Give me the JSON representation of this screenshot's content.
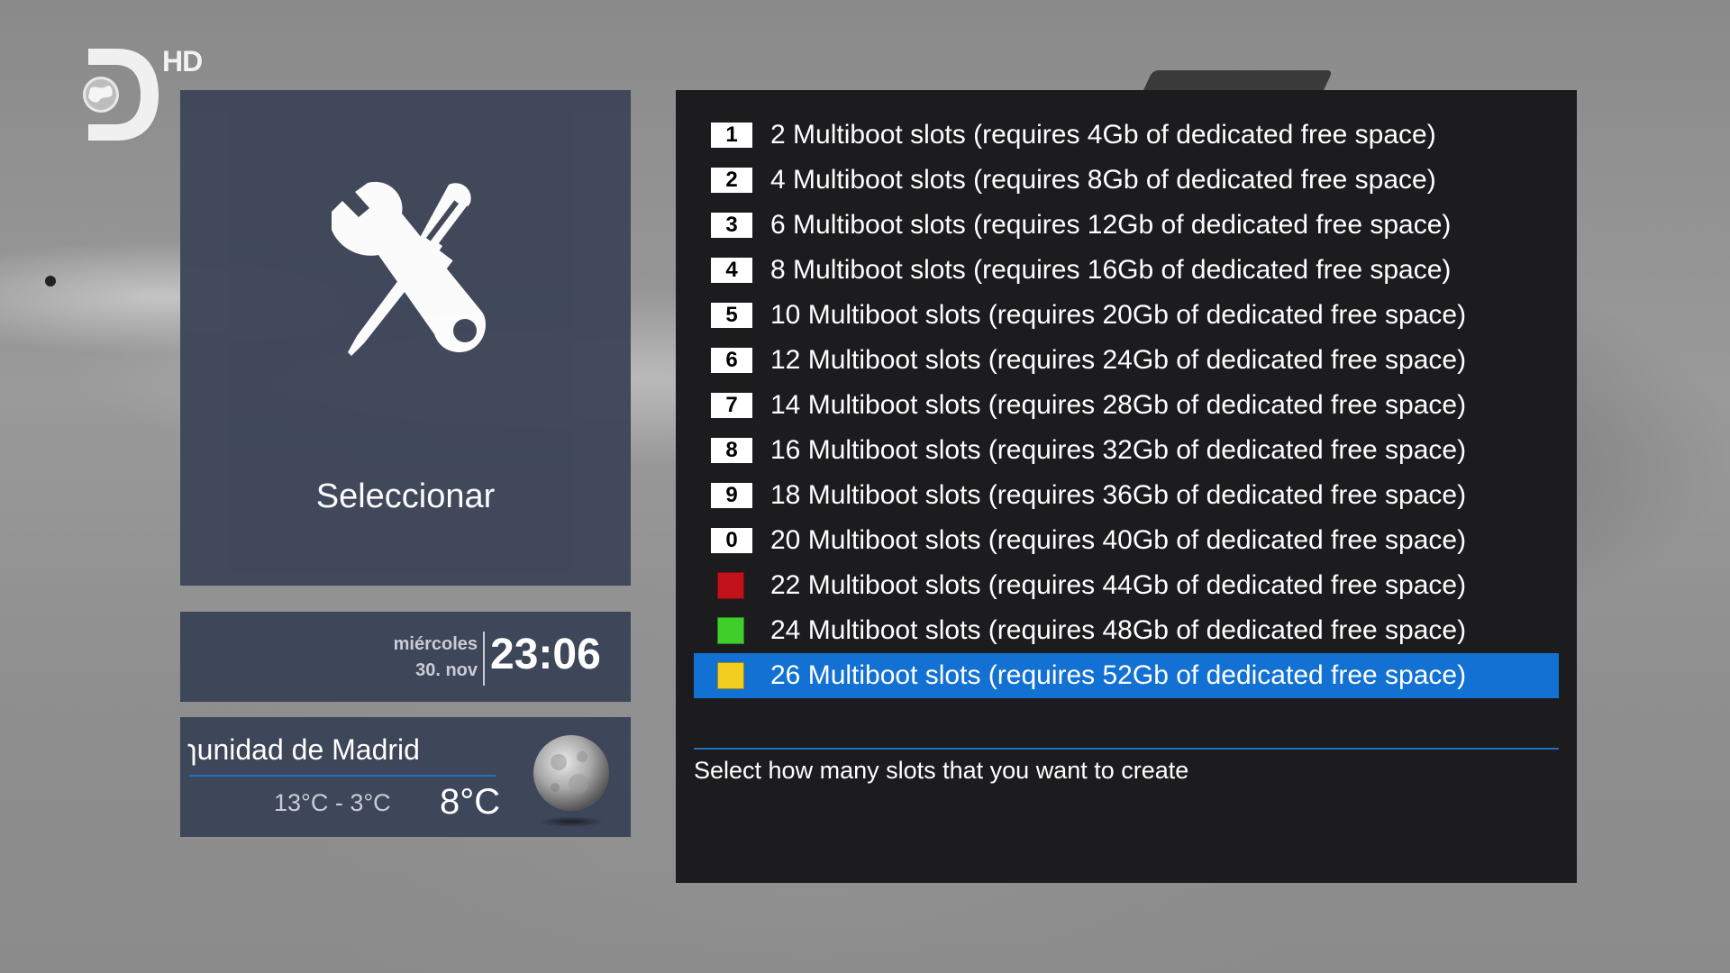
{
  "channel": {
    "logo_icon": "discovery-d-globe-icon",
    "hd_label": "HD"
  },
  "menu_panel": {
    "icon": "tools-wrench-screwdriver-icon",
    "label": "Seleccionar"
  },
  "clock": {
    "weekday": "miércoles",
    "date": "30. nov",
    "time": "23:06"
  },
  "weather": {
    "location": "ɿunidad de Madrid",
    "range": "13°C - 3°C",
    "temperature": "8°C",
    "icon": "moon-icon"
  },
  "list": {
    "selected_index": 12,
    "items": [
      {
        "key": "1",
        "label": "2 Multiboot slots (requires 4Gb of dedicated free space)"
      },
      {
        "key": "2",
        "label": "4 Multiboot slots (requires 8Gb of dedicated free space)"
      },
      {
        "key": "3",
        "label": "6 Multiboot slots (requires 12Gb of dedicated free space)"
      },
      {
        "key": "4",
        "label": "8 Multiboot slots (requires 16Gb of dedicated free space)"
      },
      {
        "key": "5",
        "label": "10 Multiboot slots (requires 20Gb of dedicated free space)"
      },
      {
        "key": "6",
        "label": "12 Multiboot slots (requires 24Gb of dedicated free space)"
      },
      {
        "key": "7",
        "label": "14 Multiboot slots (requires 28Gb of dedicated free space)"
      },
      {
        "key": "8",
        "label": "16 Multiboot slots (requires 32Gb of dedicated free space)"
      },
      {
        "key": "9",
        "label": "18 Multiboot slots (requires 36Gb of dedicated free space)"
      },
      {
        "key": "0",
        "label": "20 Multiboot slots (requires 40Gb of dedicated free space)"
      },
      {
        "color": "#c1121a",
        "color_name": "red",
        "label": "22 Multiboot slots (requires 44Gb of dedicated free space)"
      },
      {
        "color": "#3ecf2a",
        "color_name": "green",
        "label": "24 Multiboot slots (requires 48Gb of dedicated free space)"
      },
      {
        "color": "#f2cf1e",
        "color_name": "yellow",
        "label": "26 Multiboot slots (requires 52Gb of dedicated free space)"
      }
    ]
  },
  "description": "Select how many slots that you want to create",
  "colors": {
    "panel": "#3e4659",
    "list_background": "#1c1c1e",
    "selection": "#1271d3",
    "accent_line": "#1f6fc4"
  }
}
